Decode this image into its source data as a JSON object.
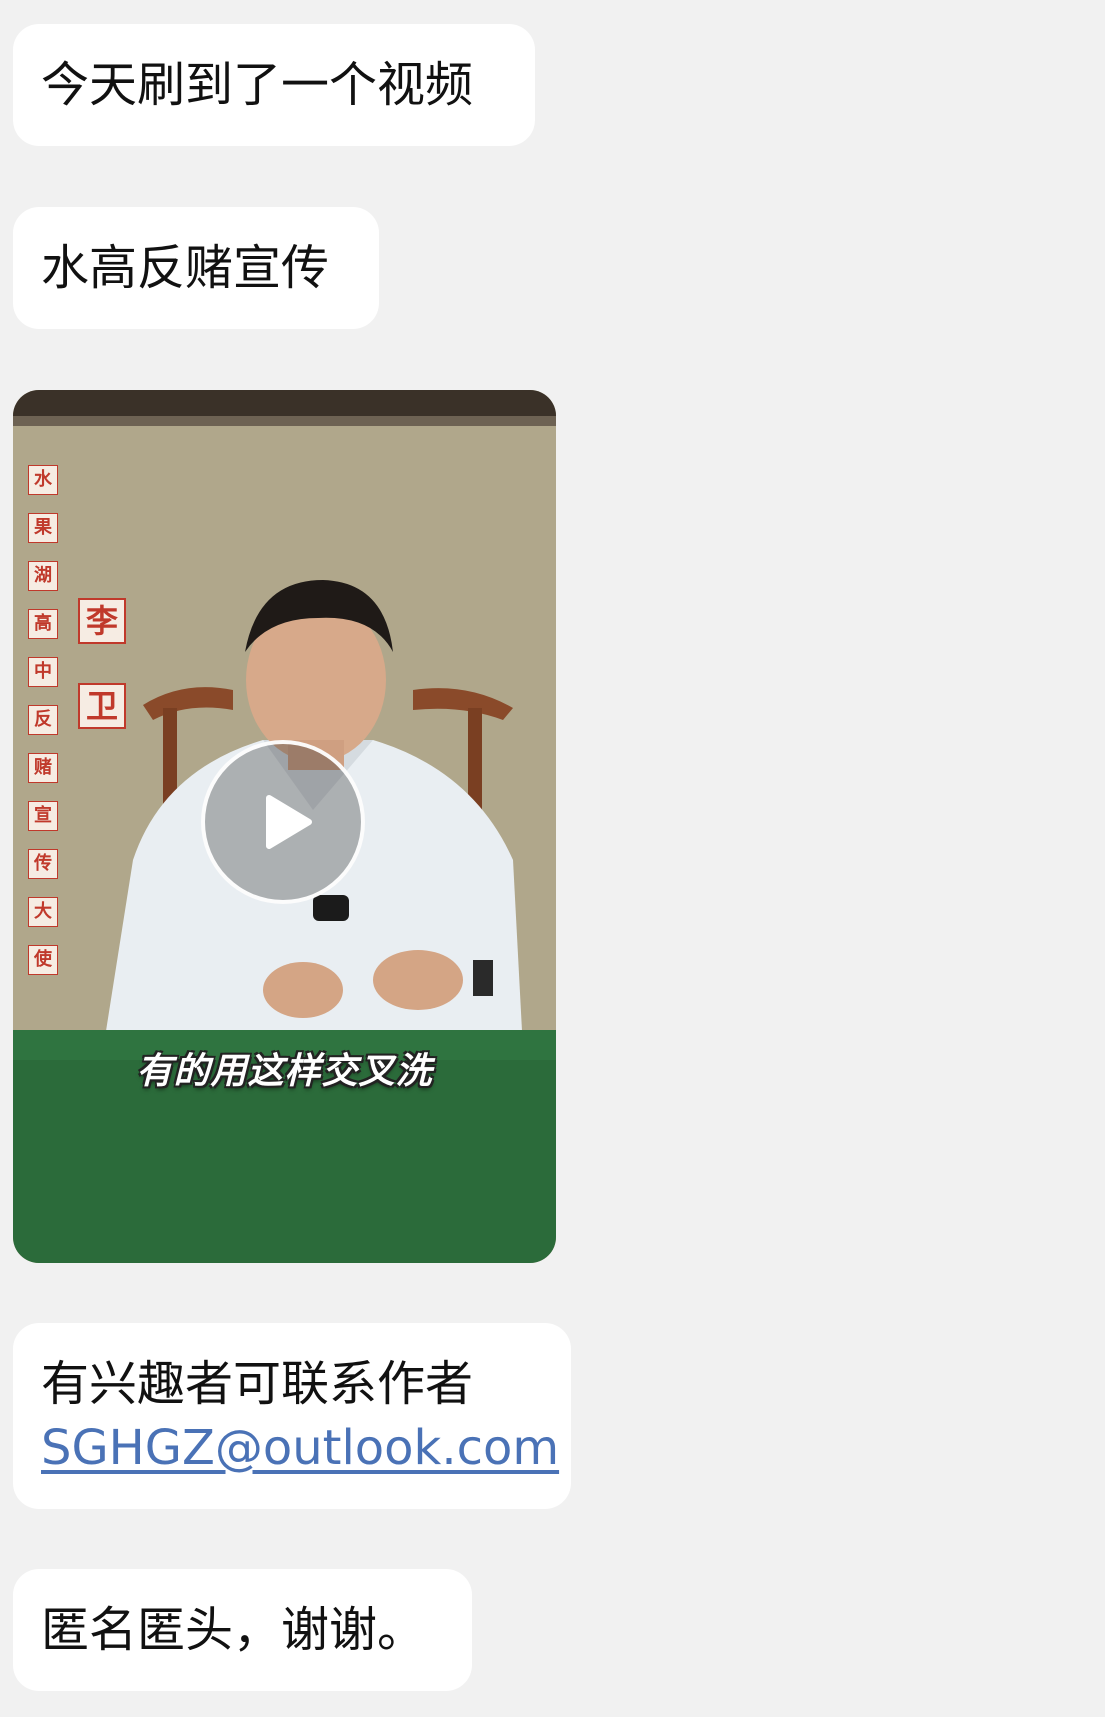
{
  "messages": [
    {
      "text": "今天刷到了一个视频"
    },
    {
      "text": "水高反赌宣传"
    },
    {
      "type": "video",
      "vertical_banner": [
        "水",
        "果",
        "湖",
        "高",
        "中",
        "反",
        "赌",
        "宣",
        "传",
        "大",
        "使"
      ],
      "name_tags": [
        "李",
        "卫"
      ],
      "subtitle": "有的用这样交叉洗",
      "play_icon": "play-icon"
    },
    {
      "line1": "有兴趣者可联系作者",
      "email": "SGHGZ@outlook.com"
    },
    {
      "text": "匿名匿头，谢谢。"
    }
  ],
  "colors": {
    "background": "#f1f1f1",
    "bubble": "#ffffff",
    "link": "#4a72b6",
    "table_green": "#2b6b3a",
    "banner_red": "#c0392b"
  }
}
